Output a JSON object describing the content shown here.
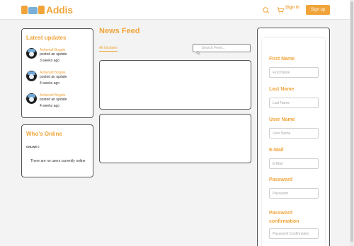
{
  "header": {
    "brand": "Addis",
    "sign_in_label": "Sign in",
    "sign_up_label": "Sign up",
    "accent_color": "#f0a43a"
  },
  "latest_updates": {
    "title": "Latest updates",
    "items": [
      {
        "name": "Ashenafi Bogale",
        "action": "posted an update",
        "time": "3 weeks ago"
      },
      {
        "name": "Ashenafi Bogale",
        "action": "posted an update",
        "time": "4 weeks ago"
      },
      {
        "name": "Ashenafi Bogale",
        "action": "posted an update",
        "time": "4 weeks ago"
      }
    ]
  },
  "whos_online": {
    "title": "Who's Online",
    "label": "ONLINE 0",
    "empty_text": "There are no users currently online"
  },
  "news_feed": {
    "title": "News Feed",
    "tab_label": "All Updates",
    "search_placeholder": "Search Feed..."
  },
  "register": {
    "fields": [
      {
        "label": "First Name",
        "placeholder": "First Name"
      },
      {
        "label": "Last Name",
        "placeholder": "Last Name"
      },
      {
        "label": "User Name",
        "placeholder": "User Name"
      },
      {
        "label": "E-Mail",
        "placeholder": "E-Mail"
      },
      {
        "label": "Password",
        "placeholder": "Password"
      },
      {
        "label": "Password confirmation",
        "placeholder": "Password Confirmation"
      }
    ]
  }
}
